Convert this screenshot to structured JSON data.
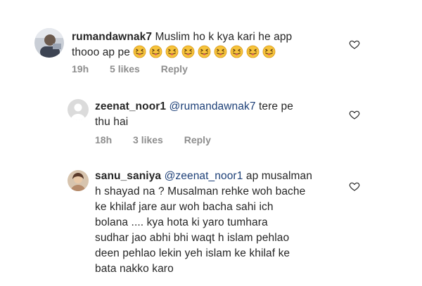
{
  "comments": [
    {
      "username": "rumandawnak7",
      "mention": "",
      "lines": [
        "Muslim ho k kya kari he app",
        "thooo ap pe"
      ],
      "emoji_count": 9,
      "emoji_name": "face-with-tongue-squinting-emoji",
      "time": "19h",
      "likes": "5 likes",
      "reply": "Reply"
    },
    {
      "username": "zeenat_noor1",
      "mention": "@rumandawnak7",
      "lines": [
        "tere pe",
        "thu hai"
      ],
      "time": "18h",
      "likes": "3 likes",
      "reply": "Reply"
    },
    {
      "username": "sanu_saniya",
      "mention": "@zeenat_noor1",
      "lines": [
        "ap musalman",
        "h shayad na ? Musalman rehke woh bache",
        "ke khilaf jare aur woh bacha sahi ich",
        "bolana .... kya hota ki yaro tumhara",
        "sudhar jao abhi bhi waqt h islam pehlao",
        "deen pehlao lekin yeh islam ke khilaf ke",
        "bata nakko karo"
      ]
    }
  ],
  "icons": {
    "like": "heart-outline-icon",
    "avatar_default": "default-avatar-icon"
  },
  "colors": {
    "text": "#262626",
    "mention": "#1c3f77",
    "meta": "#8e8e8e",
    "emoji": "#f6c33b"
  }
}
